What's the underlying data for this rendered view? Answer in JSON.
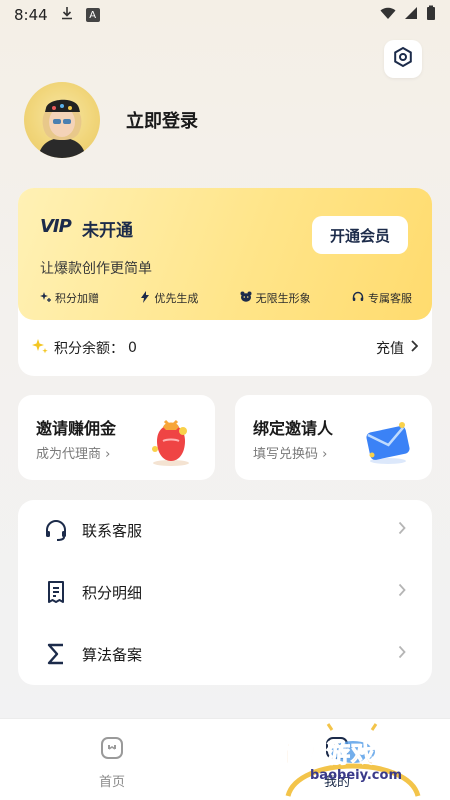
{
  "status_bar": {
    "time": "8:44",
    "a_label": "A"
  },
  "profile": {
    "login_label": "立即登录"
  },
  "vip": {
    "logo": "VIP",
    "status": "未开通",
    "open_button": "开通会员",
    "slogan": "让爆款创作更简单",
    "perks": [
      {
        "icon": "sparkle-plus-icon",
        "label": "积分加赠"
      },
      {
        "icon": "lightning-icon",
        "label": "优先生成"
      },
      {
        "icon": "bear-face-icon",
        "label": "无限生形象"
      },
      {
        "icon": "headset-icon",
        "label": "专属客服"
      }
    ],
    "points_label": "积分余额：",
    "points_value": "0",
    "recharge": "充值"
  },
  "cards": {
    "invite": {
      "title": "邀请赚佣金",
      "sub": "成为代理商 ›"
    },
    "bind": {
      "title": "绑定邀请人",
      "sub": "填写兑换码 ›"
    }
  },
  "menu": [
    {
      "icon": "headset-icon",
      "label": "联系客服"
    },
    {
      "icon": "receipt-icon",
      "label": "积分明细"
    },
    {
      "icon": "sigma-icon",
      "label": "算法备案"
    }
  ],
  "nav": {
    "home": "首页",
    "mine": "我的"
  },
  "watermark": {
    "text": "宝贝游戏网",
    "url": "baobeiy.com"
  },
  "colors": {
    "vip_gold": "#ffe58a",
    "navy": "#1c2b4a",
    "accent_orange": "#f08a1a"
  }
}
